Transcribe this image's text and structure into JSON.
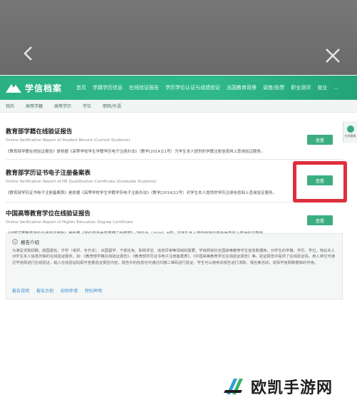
{
  "header": {
    "logo_text": "学信档案",
    "nav": [
      "首页",
      "学籍学历信息",
      "在线验证报告",
      "学历学位认证与成绩验证",
      "出国教育背景",
      "调查/投票",
      "职业测评",
      "就业",
      "..."
    ]
  },
  "subnav": [
    "我的",
    "高等学籍",
    "高等学历",
    "学位",
    "职称/外语"
  ],
  "cards": [
    {
      "title": "教育部学籍在线验证报告",
      "subtitle": "Online Verification Report of Student Record (Current Students)",
      "desc": "《教育部学籍在线验证报告》是依据《高等学校学生学籍学历电子注册办法》（教学[2014]11号）为学生本人提供的学籍注册信息网上查询验证服务。",
      "button": "查看"
    },
    {
      "title": "教育部学历证书电子注册备案表",
      "subtitle": "Online Verification Report of HE Qualification Certificate (Graduate Students)",
      "desc": "《教育部学历证书电子注册备案表》是依据《高等学校学生学籍学历电子注册办法》（教学[2014]11号）对学生本人提供的学历注册信息网上查询验证服务。",
      "button": "查看"
    },
    {
      "title": "中国高等教育学位在线验证报告",
      "subtitle": "Online Verification Report of Higher Education Degree Certificate",
      "desc": "《中国高等教育学位在线验证报告》是依据《学位授予信息管理工作规程》（学位办〔2020〕8号）对学生本人提供的学位授予信息网上查询验证服务。",
      "button": "查看"
    }
  ],
  "info": {
    "title": "报告介绍",
    "text": "为满足求职招聘、跨国报名、升学（考研、专升本）、出国留学、干部任免、职称评定、信息评审等领域的需要，学信网依托全国高等教育学生信息数据库，对学生的学籍、学历、学位，特此本人对学生本人信息所做的在线验证服务。如：《教育部学籍在线验证报告》、《教育部学历证书电子注册备案表》、《中国高等教育学位在线验证报告》等。验证报告中提供了在线验证码，用人单位可通过学信网进行在线验证，输入在线验证码即可查看验证报告内容，报告中的信息也可通过扫描二维码进行验证。学生可以使用本报告进行求职、报名等活动，发挥学信网数据库的作用。",
    "links": [
      "报告说明",
      "报告示例",
      "如何申请",
      "特别声明"
    ]
  },
  "side_chip": "在线客服",
  "watermark": "欧凯手游网"
}
